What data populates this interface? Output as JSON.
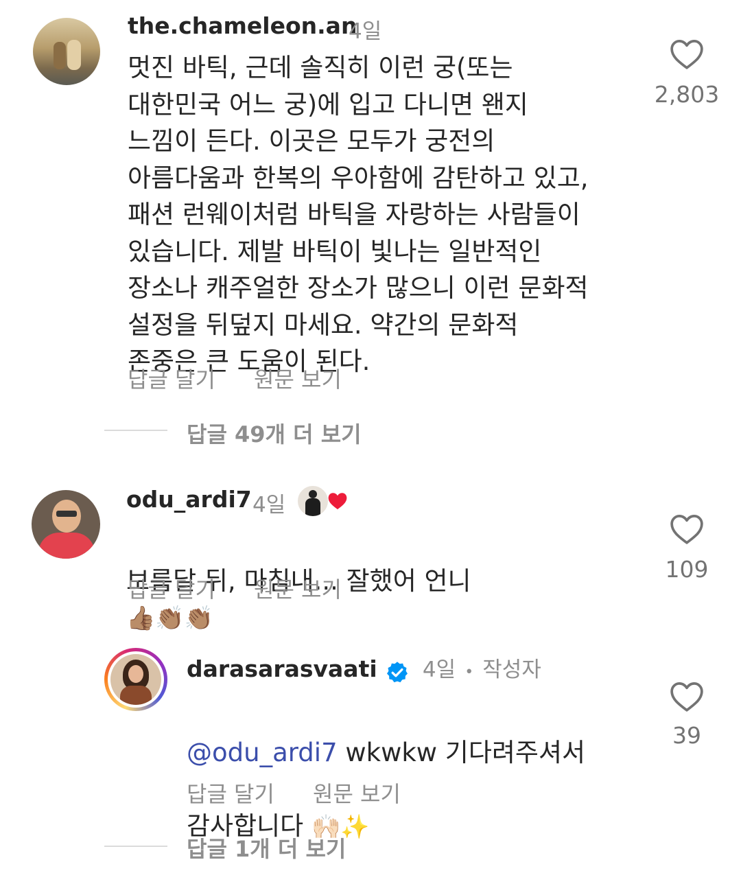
{
  "comments": [
    {
      "username": "the.chameleon.an",
      "time": "4일",
      "text": "멋진 바틱, 근데 솔직히 이런 궁(또는\n대한민국 어느 궁)에 입고 다니면 왠지\n느낌이 든다. 이곳은 모두가 궁전의\n아름다움과 한복의 우아함에 감탄하고 있고,\n패션 런웨이처럼 바틱을 자랑하는 사람들이\n있습니다. 제발 바틱이 빛나는 일반적인\n장소나 캐주얼한 장소가 많으니 이런 문화적\n설정을 뒤덮지 마세요. 약간의 문화적\n존중은 큰 도움이 된다.",
      "reply_label": "답글 달기",
      "translate_label": "원문 보기",
      "likes": "2,803",
      "more_replies": "답글 49개 더 보기"
    },
    {
      "username": "odu_ardi7",
      "time": "4일",
      "text": "보름달 뒤, 마침내... 잘했어 언니",
      "emojis": "👍🏽👏🏽👏🏽",
      "reply_label": "답글 달기",
      "translate_label": "원문 보기",
      "likes": "109"
    },
    {
      "username": "darasarasvaati",
      "time": "4일",
      "separator": "•",
      "author_badge": "작성자",
      "mention": "@odu_ardi7",
      "text_line1": " wkwkw 기다려주셔서",
      "text_line2": "감사합니다 ",
      "emojis": "🙌🏻✨",
      "reply_label": "답글 달기",
      "translate_label": "원문 보기",
      "likes": "39",
      "more_replies": "답글 1개 더 보기"
    }
  ],
  "icons": {
    "like": "heart-outline-icon",
    "verified": "verified-badge-icon",
    "creator_heart": "red-heart-icon"
  },
  "colors": {
    "text": "#262626",
    "secondary": "#8e8e8e",
    "mention": "#3b4eab",
    "verified": "#0095f6",
    "heart_red": "#ed1c3a"
  }
}
